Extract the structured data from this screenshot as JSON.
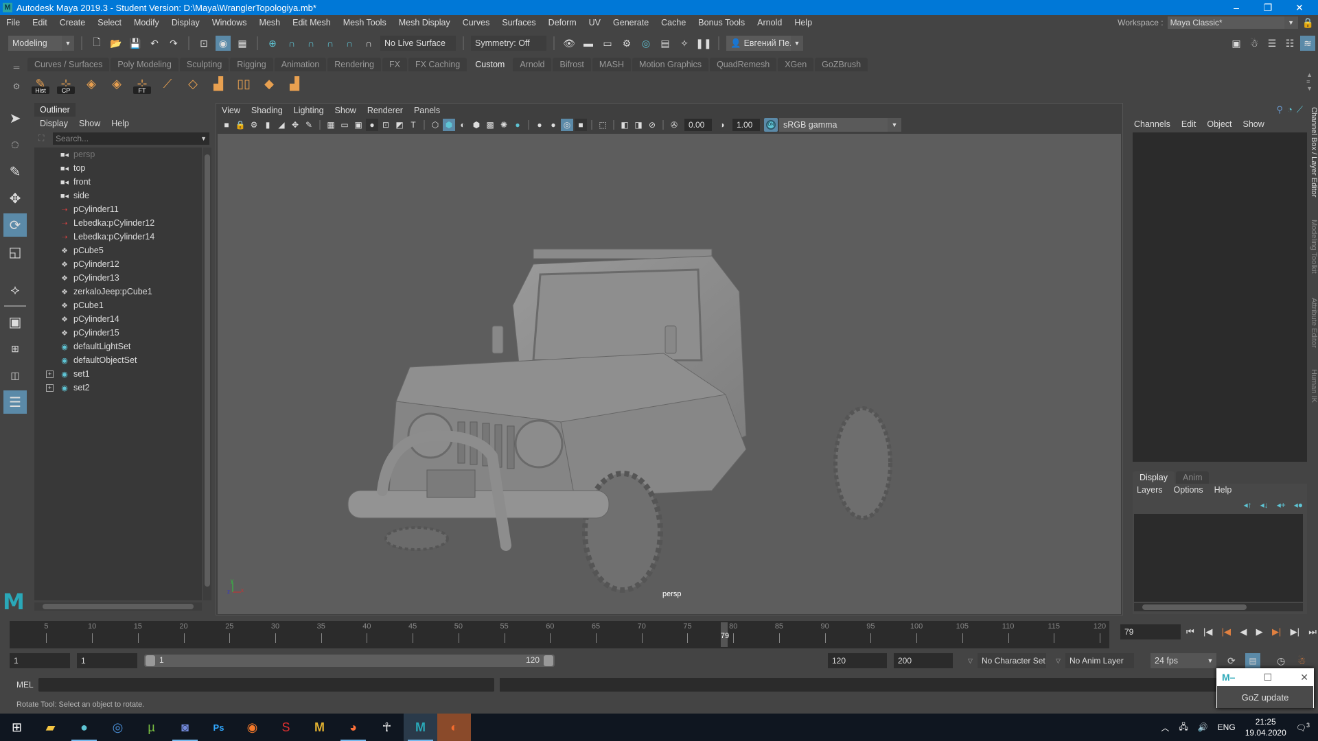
{
  "window": {
    "title": "Autodesk Maya 2019.3 - Student Version: D:\\Maya\\WranglerTopologiya.mb*",
    "app_icon": "M",
    "controls": {
      "minimize": "–",
      "restore": "❐",
      "close": "✕"
    }
  },
  "menubar": {
    "items": [
      "File",
      "Edit",
      "Create",
      "Select",
      "Modify",
      "Display",
      "Windows",
      "Mesh",
      "Edit Mesh",
      "Mesh Tools",
      "Mesh Display",
      "Curves",
      "Surfaces",
      "Deform",
      "UV",
      "Generate",
      "Cache",
      "Bonus Tools",
      "Arnold",
      "Help"
    ],
    "workspace_label": "Workspace :",
    "workspace_value": "Maya Classic*"
  },
  "statusline": {
    "menuset": "Modeling",
    "live_surface": "No Live Surface",
    "symmetry": "Symmetry: Off",
    "user": "Евгений Пе..."
  },
  "shelf": {
    "tabs": [
      "Curves / Surfaces",
      "Poly Modeling",
      "Sculpting",
      "Rigging",
      "Animation",
      "Rendering",
      "FX",
      "FX Caching",
      "Custom",
      "Arnold",
      "Bifrost",
      "MASH",
      "Motion Graphics",
      "QuadRemesh",
      "XGen",
      "GoZBrush"
    ],
    "active_tab": "Custom",
    "buttons": [
      {
        "name": "history-toggle",
        "label": "Hist"
      },
      {
        "name": "center-pivot",
        "label": "CP"
      },
      {
        "name": "combine",
        "label": ""
      },
      {
        "name": "separate",
        "label": ""
      },
      {
        "name": "freeze-transforms",
        "label": "FT"
      },
      {
        "name": "multi-cut",
        "label": ""
      },
      {
        "name": "extract",
        "label": ""
      },
      {
        "name": "bridge",
        "label": ""
      },
      {
        "name": "mirror",
        "label": ""
      },
      {
        "name": "target-weld",
        "label": ""
      },
      {
        "name": "append-polygon",
        "label": ""
      }
    ]
  },
  "outliner": {
    "title": "Outliner",
    "menu": [
      "Display",
      "Show",
      "Help"
    ],
    "search_placeholder": "Search...",
    "items": [
      {
        "label": "persp",
        "type": "camera",
        "dim": true
      },
      {
        "label": "top",
        "type": "camera"
      },
      {
        "label": "front",
        "type": "camera"
      },
      {
        "label": "side",
        "type": "camera"
      },
      {
        "label": "pCylinder11",
        "type": "reference"
      },
      {
        "label": "Lebedka:pCylinder12",
        "type": "reference"
      },
      {
        "label": "Lebedka:pCylinder14",
        "type": "reference"
      },
      {
        "label": "pCube5",
        "type": "mesh"
      },
      {
        "label": "pCylinder12",
        "type": "mesh"
      },
      {
        "label": "pCylinder13",
        "type": "mesh"
      },
      {
        "label": "zerkaloJeep:pCube1",
        "type": "mesh"
      },
      {
        "label": "pCube1",
        "type": "mesh"
      },
      {
        "label": "pCylinder14",
        "type": "mesh"
      },
      {
        "label": "pCylinder15",
        "type": "mesh"
      },
      {
        "label": "defaultLightSet",
        "type": "set"
      },
      {
        "label": "defaultObjectSet",
        "type": "set"
      },
      {
        "label": "set1",
        "type": "set",
        "expandable": true
      },
      {
        "label": "set2",
        "type": "set",
        "expandable": true
      }
    ]
  },
  "viewport": {
    "menu": [
      "View",
      "Shading",
      "Lighting",
      "Show",
      "Renderer",
      "Panels"
    ],
    "exposure": "0.00",
    "gamma": "1.00",
    "color_mgmt_on": "ON",
    "view_transform": "sRGB gamma",
    "camera_label": "persp",
    "axis": {
      "x": "x",
      "y": "y",
      "z": "z"
    }
  },
  "channel_box": {
    "menu": [
      "Channels",
      "Edit",
      "Object",
      "Show"
    ],
    "side_tabs": [
      "Channel Box / Layer Editor",
      "Modeling Toolkit",
      "Attribute Editor",
      "Human IK"
    ]
  },
  "layer_editor": {
    "tabs": [
      "Display",
      "Anim"
    ],
    "active_tab": "Display",
    "menu": [
      "Layers",
      "Options",
      "Help"
    ]
  },
  "timeline": {
    "ticks": [
      5,
      10,
      15,
      20,
      25,
      30,
      35,
      40,
      45,
      50,
      55,
      60,
      65,
      70,
      75,
      80,
      85,
      90,
      95,
      100,
      105,
      110,
      115,
      120
    ],
    "range_start": 1,
    "range_end": 120,
    "current_frame": "79"
  },
  "range": {
    "start_time": "1",
    "playback_start": "1",
    "slider_start": "1",
    "slider_end": "120",
    "playback_end": "120",
    "end_time": "200",
    "character_set": "No Character Set",
    "anim_layer": "No Anim Layer",
    "fps": "24 fps"
  },
  "cmdline": {
    "label": "MEL"
  },
  "helpline": {
    "text": "Rotate Tool: Select an object to rotate."
  },
  "goz_window": {
    "button": "GoZ update"
  },
  "taskbar": {
    "apps": [
      "start",
      "file-explorer",
      "steam-like",
      "teamviewer",
      "utorrent",
      "discord",
      "photoshop",
      "blender",
      "substance-painter",
      "marmoset",
      "firefox",
      "zbrush",
      "maya",
      "origin"
    ],
    "tray": {
      "lang": "ENG",
      "time": "21:25",
      "date": "19.04.2020",
      "notifications": "3"
    }
  }
}
